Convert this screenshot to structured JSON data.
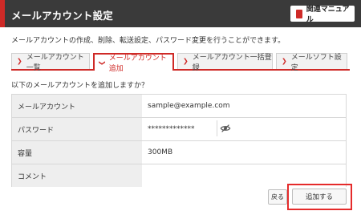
{
  "header": {
    "title": "メールアカウント設定",
    "manual_label": "関連マニュアル"
  },
  "description": "メールアカウントの作成、削除、転送設定、パスワード変更を行うことができます。",
  "tabs": [
    {
      "label": "メールアカウント一覧",
      "active": false
    },
    {
      "label": "メールアカウント追加",
      "active": true
    },
    {
      "label": "メールアカウント一括登録",
      "active": false
    },
    {
      "label": "メールソフト設定",
      "active": false
    }
  ],
  "question": "以下のメールアカウントを追加しますか？",
  "form": {
    "rows": [
      {
        "label": "メールアカウント",
        "value": "sample@example.com"
      },
      {
        "label": "パスワード",
        "value": "*************"
      },
      {
        "label": "容量",
        "value": "300MB"
      },
      {
        "label": "コメント",
        "value": ""
      }
    ]
  },
  "buttons": {
    "back_label": "戻る",
    "add_label": "追加する"
  },
  "colors": {
    "accent": "#cf2a27",
    "header_bg": "#3a3a3a",
    "highlight": "#e52b2b"
  },
  "icons": {
    "manual": "book-icon",
    "tab_chevron": "chevron-right-icon",
    "password_toggle": "eye-slash-icon"
  }
}
